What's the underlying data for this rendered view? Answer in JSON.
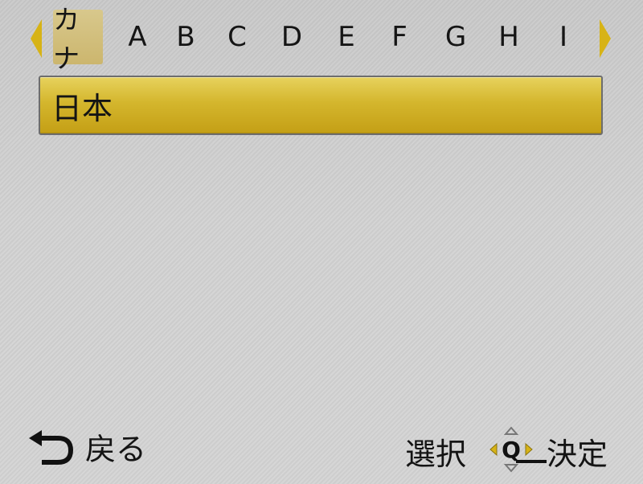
{
  "tabs": {
    "items": [
      {
        "label": "カナ",
        "active": true
      },
      {
        "label": "A",
        "active": false
      },
      {
        "label": "B",
        "active": false
      },
      {
        "label": "C",
        "active": false
      },
      {
        "label": "D",
        "active": false
      },
      {
        "label": "E",
        "active": false
      },
      {
        "label": "F",
        "active": false
      },
      {
        "label": "G",
        "active": false
      },
      {
        "label": "H",
        "active": false
      },
      {
        "label": "I",
        "active": false
      }
    ],
    "left_arrow_icon": "triangle-left-icon",
    "right_arrow_icon": "triangle-right-icon"
  },
  "list": {
    "items": [
      {
        "label": "日本",
        "selected": true
      }
    ]
  },
  "footer": {
    "back_icon": "return-arrow-icon",
    "back_label": "戻る",
    "select_label": "選択",
    "nav_icon": "dpad-q-icon",
    "confirm_label": "決定"
  },
  "colors": {
    "accent": "#d7b316",
    "selection": "#d4b62d",
    "background": "#d0d0d0"
  }
}
